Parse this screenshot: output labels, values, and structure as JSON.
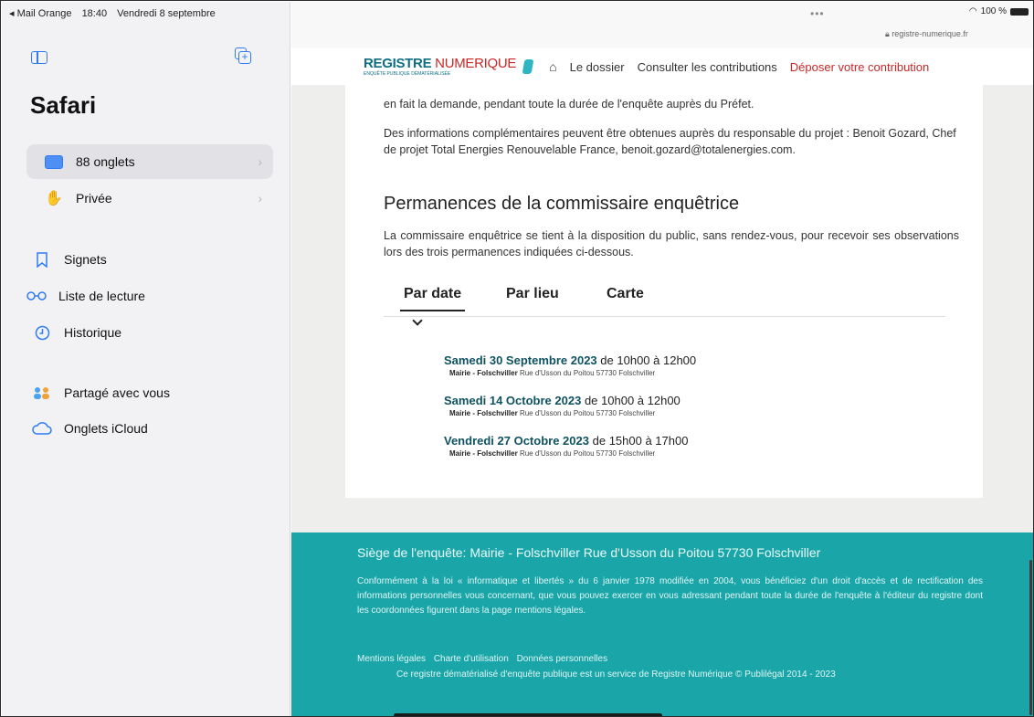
{
  "status": {
    "carrier": "◂ Mail Orange",
    "time": "18:40",
    "date": "Vendredi 8 septembre",
    "battery": "100 %"
  },
  "sidebar": {
    "title": "Safari",
    "items": [
      {
        "label": "88 onglets",
        "icon": "tabs-icon"
      },
      {
        "label": "Privée",
        "icon": "hand-icon"
      },
      {
        "label": "Signets",
        "icon": "bookmark-icon"
      },
      {
        "label": "Liste de lecture",
        "icon": "glasses-icon"
      },
      {
        "label": "Historique",
        "icon": "clock-icon"
      },
      {
        "label": "Partagé avec vous",
        "icon": "people-icon"
      },
      {
        "label": "Onglets iCloud",
        "icon": "cloud-icon"
      }
    ]
  },
  "browser": {
    "url": "registre-numerique.fr"
  },
  "nav": {
    "logo_a": "REGISTRE",
    "logo_b": "NUMERIQUE",
    "logo_sub": "ENQUÊTE PUBLIQUE DÉMATÉRIALISÉE",
    "link_dossier": "Le dossier",
    "link_consult": "Consulter les contributions",
    "link_deposer": "Déposer votre contribution"
  },
  "main": {
    "para1": "en fait la demande, pendant toute la durée de l'enquête auprès du Préfet.",
    "para2": "Des informations complémentaires peuvent être obtenues auprès du responsable du projet : Benoit Gozard, Chef de projet Total Energies Renouvelable France, benoit.gozard@totalenergies.com.",
    "heading": "Permanences de la commissaire enquêtrice",
    "para3": "La commissaire enquêtrice se tient à la disposition du public, sans rendez-vous, pour recevoir ses observations lors des trois permanences indiquées ci-dessous.",
    "tabs": [
      "Par date",
      "Par lieu",
      "Carte"
    ],
    "permanences": [
      {
        "date": "Samedi 30 Septembre 2023",
        "de": "de",
        "hours": "10h00 à 12h00",
        "place": "Mairie - Folschviller",
        "address": "Rue d'Usson du Poitou 57730 Folschviller"
      },
      {
        "date": "Samedi 14 Octobre 2023",
        "de": "de",
        "hours": "10h00 à 12h00",
        "place": "Mairie - Folschviller",
        "address": "Rue d'Usson du Poitou 57730 Folschviller"
      },
      {
        "date": "Vendredi 27 Octobre 2023",
        "de": "de",
        "hours": "15h00 à 17h00",
        "place": "Mairie - Folschviller",
        "address": "Rue d'Usson du Poitou 57730 Folschviller"
      }
    ]
  },
  "footer": {
    "siege": "Siège de l'enquête: Mairie - Folschviller Rue d'Usson du Poitou 57730 Folschviller",
    "text": "Conformément à la loi « informatique et libertés » du 6 janvier 1978 modifiée en 2004, vous bénéficiez d'un droit d'accès et de rectification des informations personnelles vous concernant, que vous pouvez exercer en vous adressant pendant toute la durée de l'enquête à l'éditeur du registre dont les coordonnées figurent dans la page mentions légales.",
    "links": [
      "Mentions légales",
      "Charte d'utilisation",
      "Données personnelles"
    ],
    "copyright": "Ce registre dématérialisé d'enquête publique est un service de Registre Numérique © Publilégal 2014 - 2023"
  },
  "colors": {
    "accent": "#2f7bf5",
    "brand": "#0f6e84",
    "red": "#c62828",
    "footer": "#1aa6a8"
  }
}
